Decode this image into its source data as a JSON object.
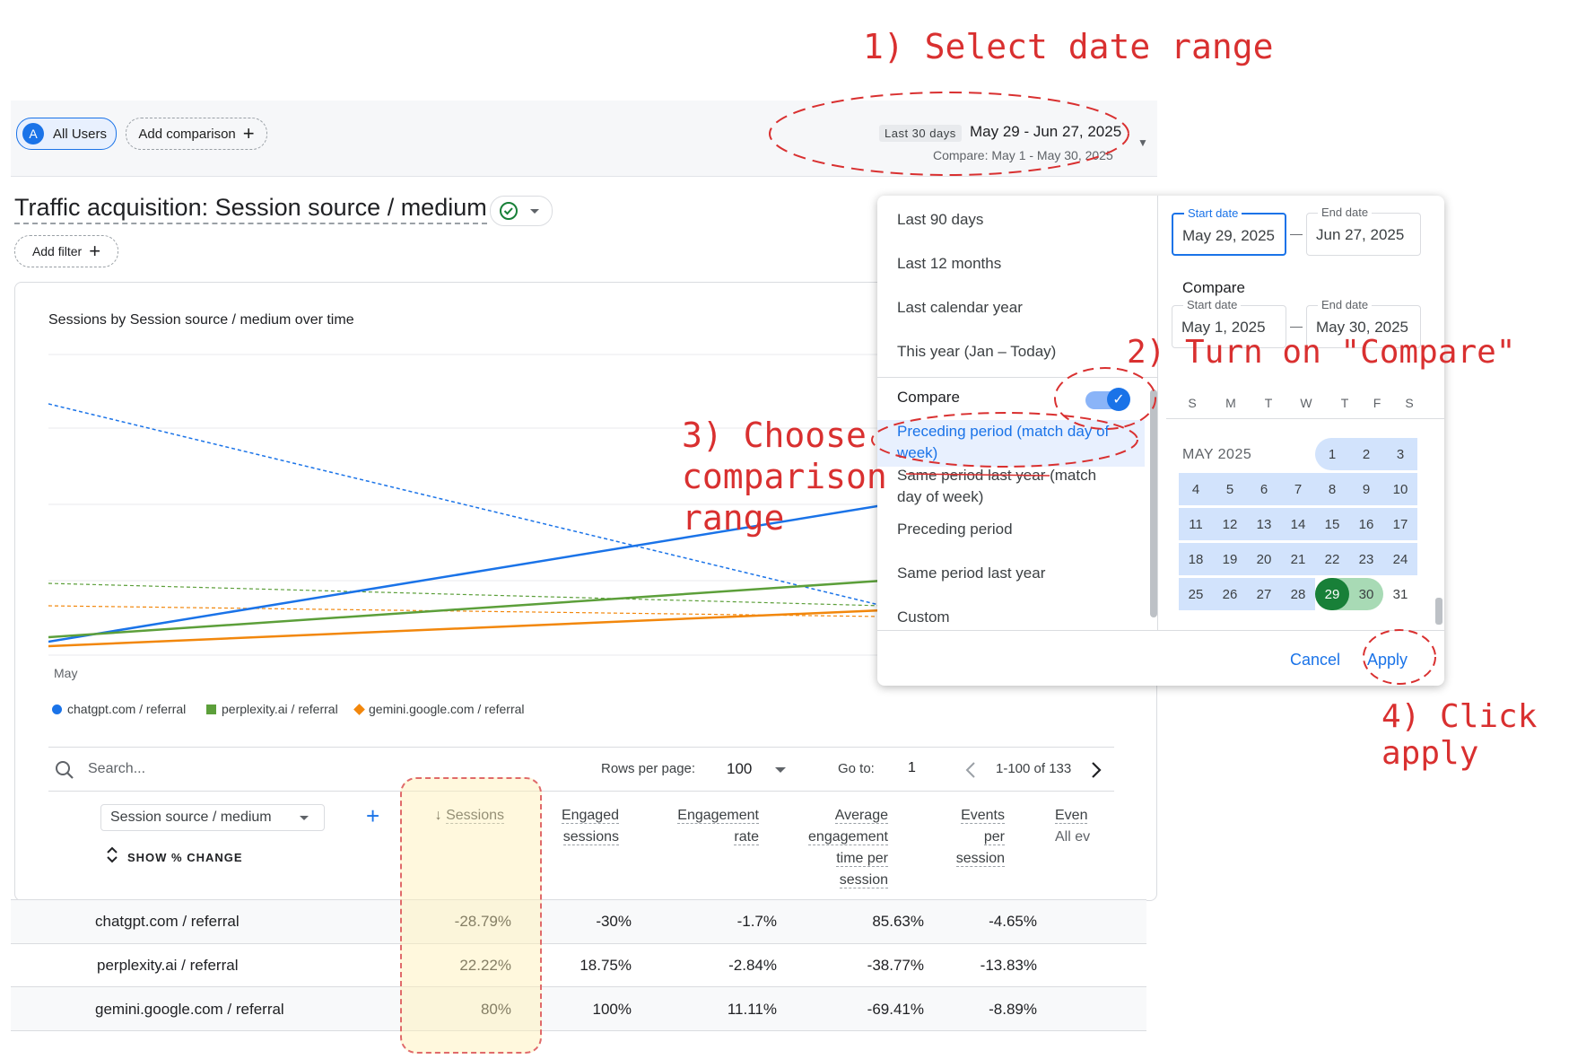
{
  "header": {
    "segment_avatar": "A",
    "segment_label": "All Users",
    "add_comparison": "Add comparison",
    "date_preset": "Last 30 days",
    "date_range": "May 29 - Jun 27, 2025",
    "compare_range": "Compare: May 1 - May 30, 2025"
  },
  "report": {
    "title": "Traffic acquisition: Session source / medium",
    "add_filter": "Add filter"
  },
  "chart": {
    "title": "Sessions by Session source / medium over time",
    "x_tick": "May",
    "legend": [
      {
        "label": "chatgpt.com / referral",
        "color": "#1a73e8"
      },
      {
        "label": "perplexity.ai / referral",
        "color": "#5c9f3a"
      },
      {
        "label": "gemini.google.com / referral",
        "color": "#f2870c"
      }
    ]
  },
  "chart_data": {
    "type": "line",
    "title": "Sessions by Session source / medium over time",
    "x": [
      "May"
    ],
    "series": [
      {
        "name": "chatgpt.com / referral",
        "color": "#1a73e8"
      },
      {
        "name": "perplexity.ai / referral",
        "color": "#5c9f3a"
      },
      {
        "name": "gemini.google.com / referral",
        "color": "#f2870c"
      }
    ],
    "grid": true,
    "legend": "bottom-left"
  },
  "table_toolbar": {
    "search_placeholder": "Search...",
    "rows_per_page_label": "Rows per page:",
    "rows_per_page": "100",
    "goto_label": "Go to:",
    "goto_value": "1",
    "range": "1-100 of 133"
  },
  "table": {
    "dimension": "Session source / medium",
    "show_change": "SHOW % CHANGE",
    "columns": {
      "sessions": "Sessions",
      "engaged_1": "Engaged",
      "engaged_2": "sessions",
      "rate_1": "Engagement",
      "rate_2": "rate",
      "avg_1": "Average",
      "avg_2": "engagement",
      "avg_3": "time per",
      "avg_4": "session",
      "events_1": "Events",
      "events_2": "per",
      "events_3": "session",
      "ev_1": "Even",
      "ev_2": "All ev"
    },
    "rows": [
      {
        "name": "chatgpt.com / referral",
        "sessions": "-28.79%",
        "engaged": "-30%",
        "rate": "-1.7%",
        "avg": "85.63%",
        "events": "-4.65%"
      },
      {
        "name": "perplexity.ai / referral",
        "sessions": "22.22%",
        "engaged": "18.75%",
        "rate": "-2.84%",
        "avg": "-38.77%",
        "events": "-13.83%"
      },
      {
        "name": "gemini.google.com / referral",
        "sessions": "80%",
        "engaged": "100%",
        "rate": "11.11%",
        "avg": "-69.41%",
        "events": "-8.89%"
      }
    ]
  },
  "date_panel": {
    "options": [
      "Last 90 days",
      "Last 12 months",
      "Last calendar year",
      "This year (Jan – Today)"
    ],
    "compare_label": "Compare",
    "compare_options": {
      "preceding_match_1": "Preceding period (match day of",
      "preceding_match_2": "week)",
      "same_last_year_match_1": "Same period last year (match",
      "same_last_year_match_2": "day of week)",
      "preceding": "Preceding period",
      "same_last_year": "Same period last year",
      "custom": "Custom"
    },
    "start_label": "Start date",
    "start_value": "May 29, 2025",
    "end_label": "End date",
    "end_value": "Jun 27, 2025",
    "compare_heading": "Compare",
    "compare_start_label": "Start date",
    "compare_start_value": "May 1, 2025",
    "compare_end_label": "End date",
    "compare_end_value": "May 30, 2025",
    "weekdays": [
      "S",
      "M",
      "T",
      "W",
      "T",
      "F",
      "S"
    ],
    "month": "MAY 2025",
    "cancel": "Cancel",
    "apply": "Apply"
  },
  "annotations": {
    "step1": "1) Select date range",
    "step2": "2) Turn on \"Compare\"",
    "step3_1": "3) Choose",
    "step3_2": "comparison",
    "step3_3": "range",
    "step4": "4) Click apply"
  }
}
